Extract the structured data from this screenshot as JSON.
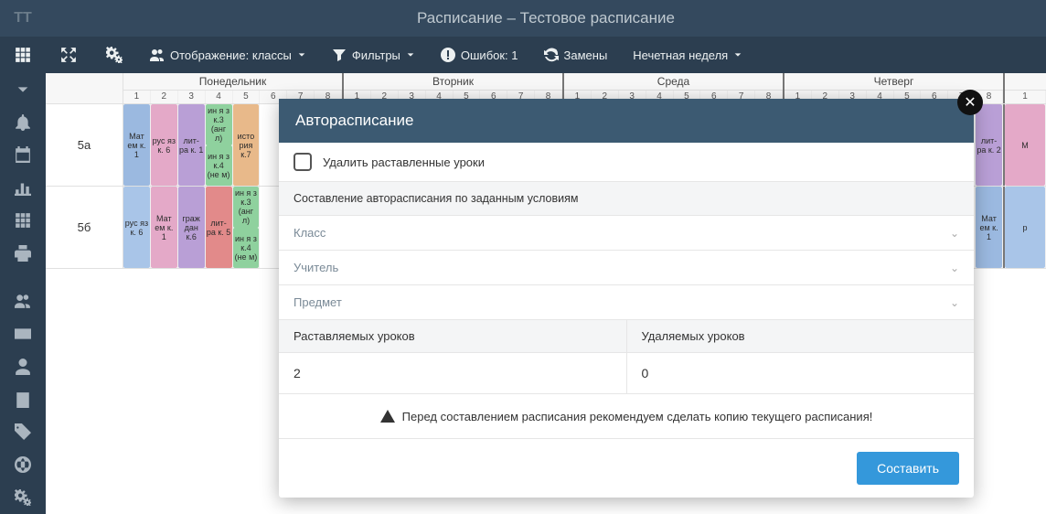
{
  "app": {
    "logo": "TT",
    "title": "Расписание – Тестовое расписание"
  },
  "toolbar": {
    "display": {
      "label": "Отображение: классы"
    },
    "filters": {
      "label": "Фильтры"
    },
    "errors": {
      "label": "Ошибок: 1"
    },
    "subs": {
      "label": "Замены"
    },
    "week": {
      "label": "Нечетная неделя"
    }
  },
  "days": [
    "Понедельник",
    "Вторник",
    "Среда",
    "Четверг"
  ],
  "periods": [
    "1",
    "2",
    "3",
    "4",
    "5",
    "6",
    "7",
    "8"
  ],
  "rows": [
    {
      "label": "5а",
      "mon": [
        [
          {
            "t": "Мат ем к. 1",
            "c": "c-blue"
          }
        ],
        [
          {
            "t": "рус яз к. 6",
            "c": "c-pink"
          }
        ],
        [
          {
            "t": "лит-ра к. 1",
            "c": "c-purple"
          }
        ],
        [
          {
            "t": "ин я з к.3 (анг л)",
            "c": "c-green"
          },
          {
            "t": "ин я з к.4 (не м)",
            "c": "c-green"
          }
        ],
        [
          {
            "t": "исто рия к.7",
            "c": "c-orange"
          }
        ],
        [],
        [],
        []
      ],
      "thu_tail": {
        "closed": true,
        "lesson": {
          "t": "лит-ра к. 2",
          "c": "c-purple"
        }
      }
    },
    {
      "label": "5б",
      "mon": [
        [
          {
            "t": "рус яз к. 6",
            "c": "c-lblue"
          }
        ],
        [
          {
            "t": "Мат ем к. 1",
            "c": "c-pink"
          }
        ],
        [
          {
            "t": "граж дан к.6",
            "c": "c-purple"
          }
        ],
        [
          {
            "t": "лит-ра к. 5",
            "c": "c-red"
          }
        ],
        [
          {
            "t": "ин я з к.3 (анг л)",
            "c": "c-green"
          },
          {
            "t": "ин я з к.4 (не м)",
            "c": "c-green"
          }
        ],
        [],
        [],
        []
      ],
      "thu_tail": {
        "closed": true,
        "lesson": {
          "t": "Мат ем к. 1",
          "c": "c-blue"
        }
      }
    }
  ],
  "modal": {
    "title": "Авторасписание",
    "delete_placed": "Удалить раставленные уроки",
    "section": "Составление авторасписания по заданным условиям",
    "class": "Класс",
    "teacher": "Учитель",
    "subject": "Предмет",
    "placing_hdr": "Раставляемых уроков",
    "deleting_hdr": "Удаляемых уроков",
    "placing_val": "2",
    "deleting_val": "0",
    "warning": "Перед составлением расписания рекомендуем сделать копию текущего расписания!",
    "submit": "Составить"
  }
}
